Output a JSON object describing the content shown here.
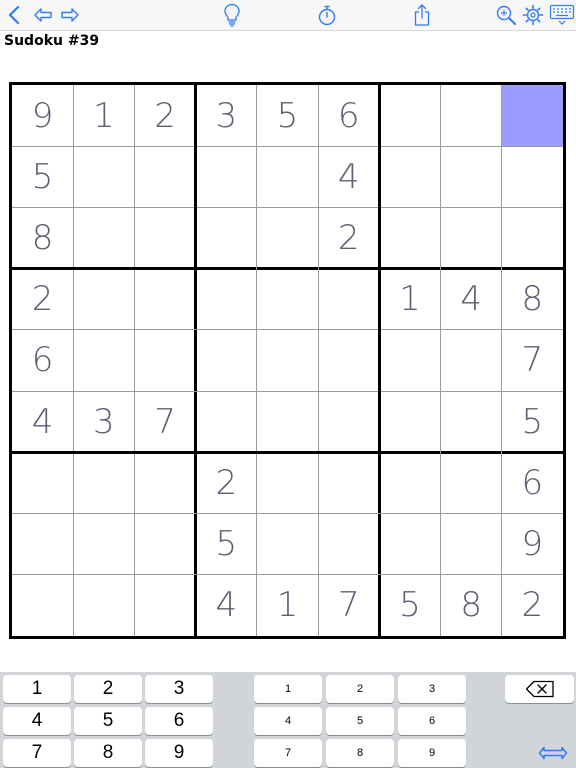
{
  "toolbar": {
    "icons": [
      "back-chevron-icon",
      "undo-arrow-icon",
      "redo-arrow-icon",
      "hint-lightbulb-icon",
      "timer-icon",
      "share-icon",
      "zoom-icon",
      "settings-gear-icon",
      "keyboard-icon"
    ],
    "accent_color": "#2f7cf6"
  },
  "title": "Sudoku #39",
  "board": {
    "selected_cell": {
      "row": 0,
      "col": 8
    },
    "selected_color": "#9a9cff",
    "digit_color": "#5d5f72",
    "grid": [
      [
        "9",
        "1",
        "2",
        "3",
        "5",
        "6",
        "",
        "",
        ""
      ],
      [
        "5",
        "",
        "",
        "",
        "",
        "4",
        "",
        "",
        ""
      ],
      [
        "8",
        "",
        "",
        "",
        "",
        "2",
        "",
        "",
        ""
      ],
      [
        "2",
        "",
        "",
        "",
        "",
        "",
        "1",
        "4",
        "8"
      ],
      [
        "6",
        "",
        "",
        "",
        "",
        "",
        "",
        "",
        "7"
      ],
      [
        "4",
        "3",
        "7",
        "",
        "",
        "",
        "",
        "",
        "5"
      ],
      [
        "",
        "",
        "",
        "2",
        "",
        "",
        "",
        "",
        "6"
      ],
      [
        "",
        "",
        "",
        "5",
        "",
        "",
        "",
        "",
        "9"
      ],
      [
        "",
        "",
        "",
        "4",
        "1",
        "7",
        "5",
        "8",
        "2"
      ]
    ]
  },
  "keypad": {
    "big_digits": [
      "1",
      "2",
      "3",
      "4",
      "5",
      "6",
      "7",
      "8",
      "9"
    ],
    "small_digits": [
      "1",
      "2",
      "3",
      "4",
      "5",
      "6",
      "7",
      "8",
      "9"
    ],
    "backspace_icon": "backspace-icon",
    "swap_icon": "swap-arrows-icon"
  }
}
